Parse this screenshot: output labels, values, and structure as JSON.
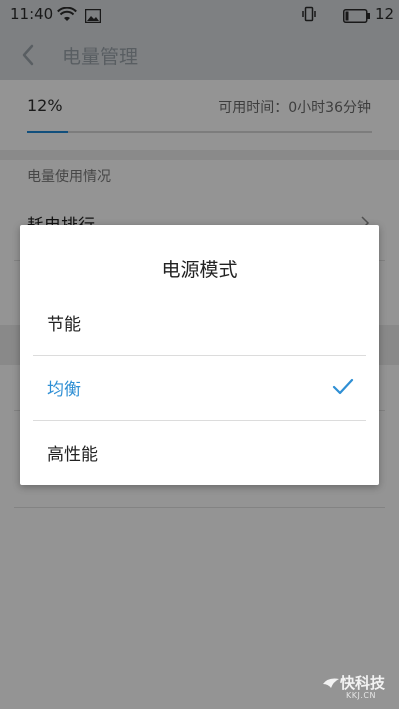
{
  "status_bar": {
    "time": "11:40",
    "battery": "12",
    "icons": [
      "wifi-icon",
      "picture-icon",
      "vibrate-icon",
      "battery-icon"
    ]
  },
  "app_bar": {
    "title": "电量管理",
    "back_icon": "chevron-left-icon"
  },
  "battery": {
    "percent_text": "12%",
    "available_time": "可用时间：0小时36分钟",
    "level_fraction": 0.12
  },
  "usage": {
    "section_title": "电量使用情况",
    "row_label": "耗电排行"
  },
  "dialog": {
    "title": "电源模式",
    "options": [
      {
        "label": "节能",
        "selected": false
      },
      {
        "label": "均衡",
        "selected": true
      },
      {
        "label": "高性能",
        "selected": false
      }
    ],
    "check_icon": "checkmark-icon"
  },
  "watermark": {
    "brand": "快科技",
    "domain": "KKJ.CN"
  },
  "colors": {
    "accent": "#2f8fd4",
    "progress": "#1e88d6",
    "bar_background": "#d9dde0"
  }
}
